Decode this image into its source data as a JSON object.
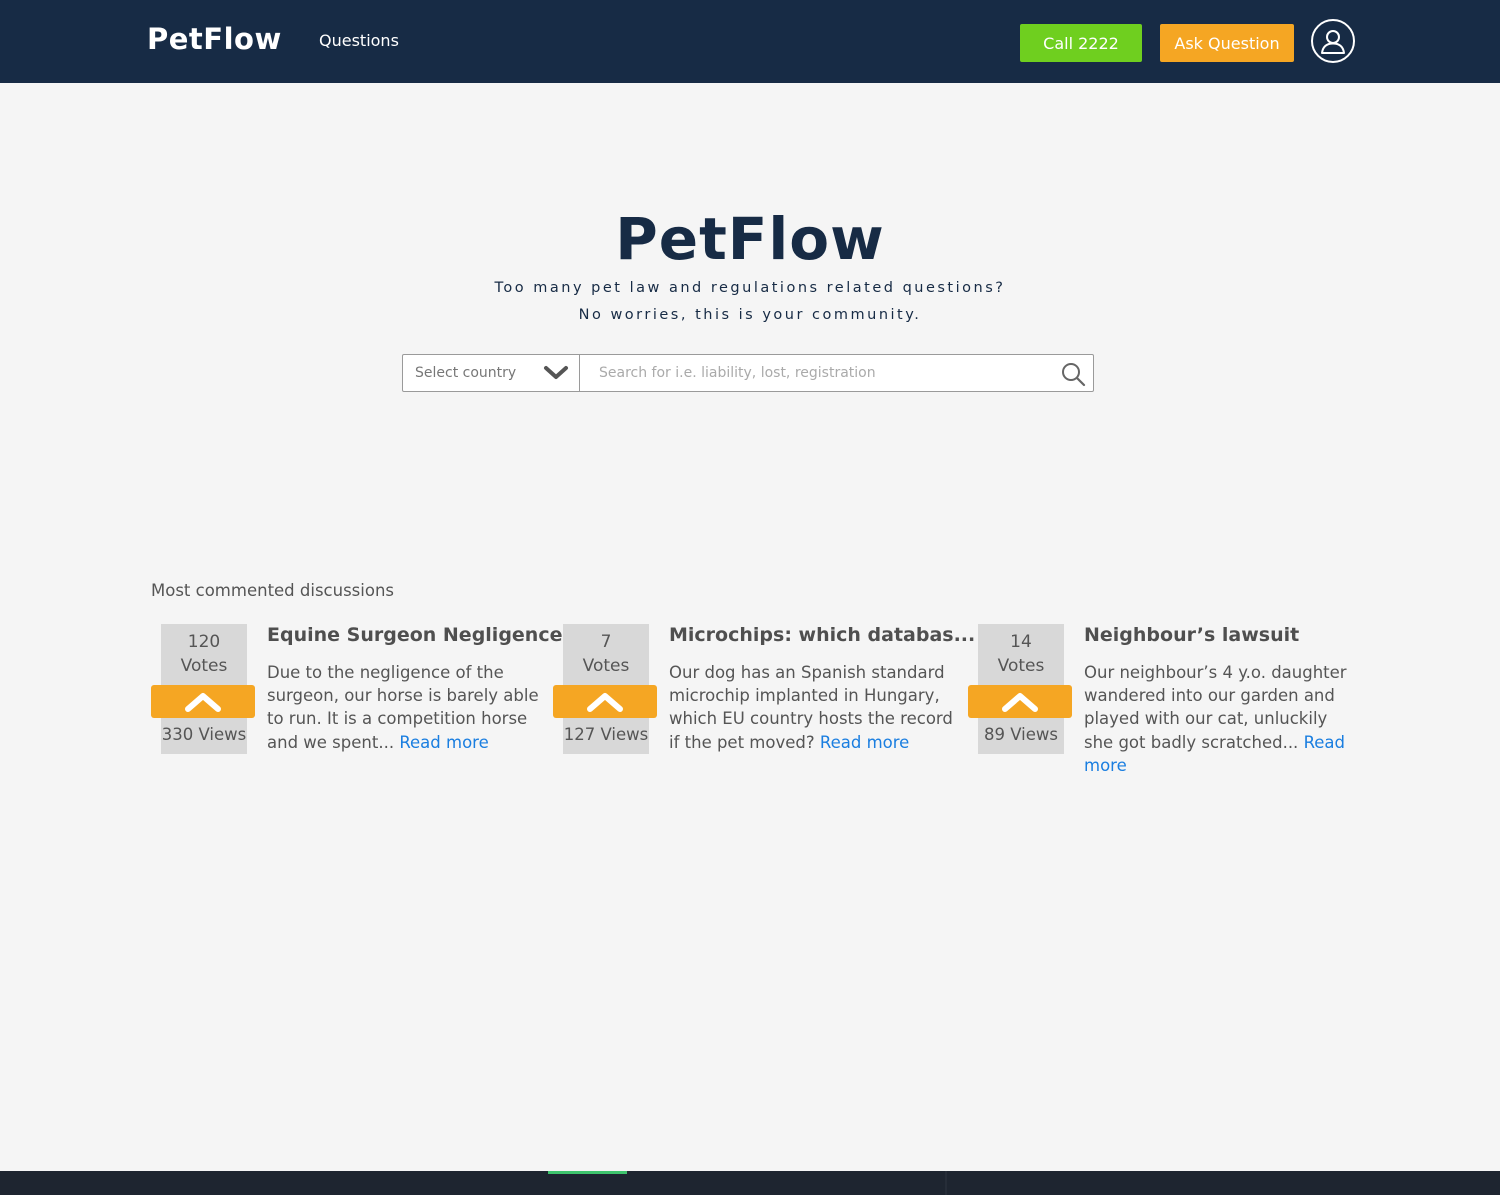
{
  "header": {
    "brand": "PetFlow",
    "nav_questions": "Questions",
    "call_label": "Call 2222",
    "ask_label": "Ask Question",
    "avatar_icon": "user-icon"
  },
  "hero": {
    "title": "PetFlow",
    "subtitle_line1": "Too many pet law and regulations related questions?",
    "subtitle_line2": "No worries, this is your community."
  },
  "search": {
    "country_label": "Select country",
    "placeholder": "Search for i.e. liability, lost, registration",
    "chevron_icon": "chevron-down-icon",
    "search_icon": "search-icon"
  },
  "discussions": {
    "section_title": "Most commented discussions",
    "upvote_icon": "chevron-up-icon",
    "items": [
      {
        "votes": "120",
        "votes_label": "Votes",
        "views": "330 Views",
        "title": "Equine Surgeon Negligence",
        "excerpt": "Due to the negligence of the surgeon, our horse is barely able to run. It is a competition horse and we spent...",
        "read_more": "Read more"
      },
      {
        "votes": "7",
        "votes_label": "Votes",
        "views": "127 Views",
        "title": "Microchips: which databas...",
        "excerpt": "Our dog has an Spanish standard microchip implanted in Hungary, which EU country hosts the record if the pet moved?",
        "read_more": "Read more"
      },
      {
        "votes": "14",
        "votes_label": "Votes",
        "views": "89 Views",
        "title": "Neighbour’s lawsuit",
        "excerpt": "Our neighbour’s 4 y.o. daughter wandered into our garden and played with our cat, unluckily she got badly scratched...",
        "read_more": "Read more"
      }
    ]
  },
  "colors": {
    "navy": "#172b45",
    "green": "#6fcf1f",
    "orange": "#f5a623",
    "link": "#1a7ee0"
  }
}
